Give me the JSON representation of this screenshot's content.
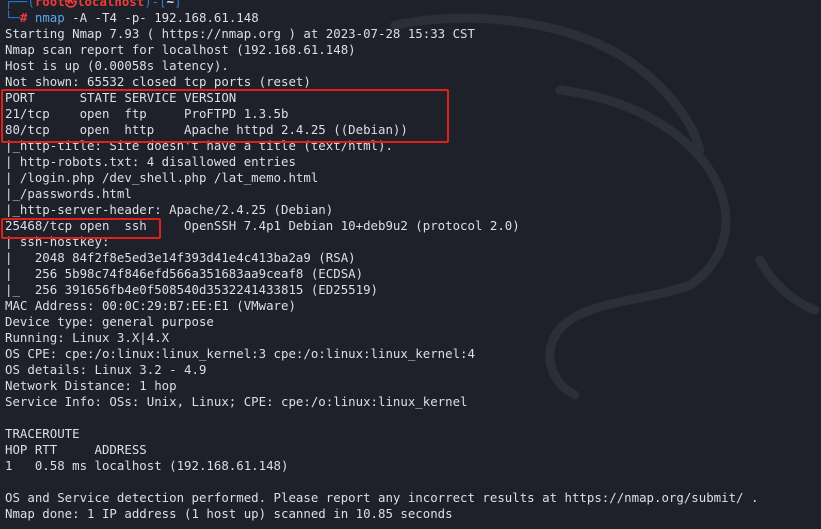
{
  "colors": {
    "background": "#1e2129",
    "text": "#dcdfe4",
    "prompt_user": "#ef3b3b",
    "prompt_bracket": "#2f7bd4",
    "command": "#5aa7e8",
    "highlight_border": "#e0201a"
  },
  "prompt": {
    "top_prefix": "┌──(",
    "user_host": "root㉿localhost",
    "mid": ")-[",
    "cwd": "~",
    "top_suffix": "]",
    "bottom_prefix": "└─",
    "hash": "#",
    "command": "nmap",
    "args": " -A -T4 -p- 192.168.61.148"
  },
  "output_lines": [
    "Starting Nmap 7.93 ( https://nmap.org ) at 2023-07-28 15:33 CST",
    "Nmap scan report for localhost (192.168.61.148)",
    "Host is up (0.00058s latency).",
    "Not shown: 65532 closed tcp ports (reset)",
    "PORT      STATE SERVICE VERSION",
    "21/tcp    open  ftp     ProFTPD 1.3.5b",
    "80/tcp    open  http    Apache httpd 2.4.25 ((Debian))",
    "|_http-title: Site doesn't have a title (text/html).",
    "| http-robots.txt: 4 disallowed entries",
    "| /login.php /dev_shell.php /lat_memo.html",
    "|_/passwords.html",
    "|_http-server-header: Apache/2.4.25 (Debian)",
    "25468/tcp open  ssh     OpenSSH 7.4p1 Debian 10+deb9u2 (protocol 2.0)",
    "| ssh-hostkey:",
    "|   2048 84f2f8e5ed3e14f393d41e4c413ba2a9 (RSA)",
    "|   256 5b98c74f846efd566a351683aa9ceaf8 (ECDSA)",
    "|_  256 391656fb4e0f508540d3532241433815 (ED25519)",
    "MAC Address: 00:0C:29:B7:EE:E1 (VMware)",
    "Device type: general purpose",
    "Running: Linux 3.X|4.X",
    "OS CPE: cpe:/o:linux:linux_kernel:3 cpe:/o:linux:linux_kernel:4",
    "OS details: Linux 3.2 - 4.9",
    "Network Distance: 1 hop",
    "Service Info: OSs: Unix, Linux; CPE: cpe:/o:linux:linux_kernel",
    "",
    "TRACEROUTE",
    "HOP RTT     ADDRESS",
    "1   0.58 ms localhost (192.168.61.148)",
    "",
    "OS and Service detection performed. Please report any incorrect results at https://nmap.org/submit/ .",
    "Nmap done: 1 IP address (1 host up) scanned in 10.85 seconds"
  ]
}
